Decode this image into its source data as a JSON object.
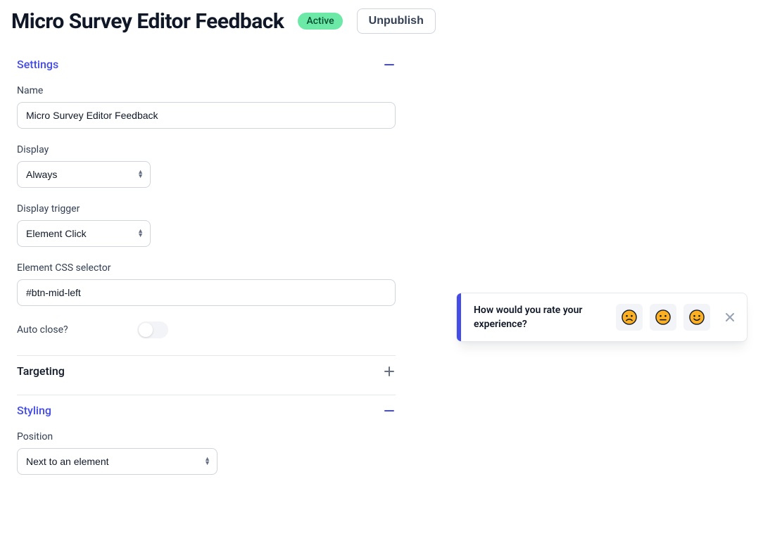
{
  "header": {
    "title": "Micro Survey Editor Feedback",
    "status_badge": "Active",
    "unpublish_label": "Unpublish"
  },
  "sections": {
    "settings": {
      "title": "Settings",
      "open": true
    },
    "targeting": {
      "title": "Targeting",
      "open": false
    },
    "styling": {
      "title": "Styling",
      "open": true
    }
  },
  "settings": {
    "name_label": "Name",
    "name_value": "Micro Survey Editor Feedback",
    "display_label": "Display",
    "display_value": "Always",
    "trigger_label": "Display trigger",
    "trigger_value": "Element Click",
    "selector_label": "Element CSS selector",
    "selector_value": "#btn-mid-left",
    "autoclose_label": "Auto close?",
    "autoclose_value": false
  },
  "styling": {
    "position_label": "Position",
    "position_value": "Next to an element"
  },
  "preview": {
    "question": "How would you rate your experience?",
    "emojis": [
      "sad",
      "neutral",
      "happy"
    ]
  }
}
